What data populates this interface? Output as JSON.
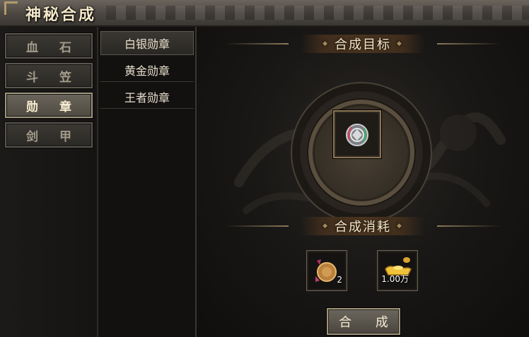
{
  "window": {
    "title": "神秘合成"
  },
  "tabs": [
    {
      "label": "血 石",
      "active": false
    },
    {
      "label": "斗 笠",
      "active": false
    },
    {
      "label": "勋 章",
      "active": true
    },
    {
      "label": "剑 甲",
      "active": false
    }
  ],
  "subitems": [
    {
      "label": "白银勋章",
      "active": true
    },
    {
      "label": "黄金勋章",
      "active": false
    },
    {
      "label": "王者勋章",
      "active": false
    }
  ],
  "target": {
    "header": "合成目标",
    "item_icon": "silver-medal-icon"
  },
  "cost": {
    "header": "合成消耗",
    "items": [
      {
        "icon": "medal-fragment-icon",
        "quantity": "2"
      },
      {
        "icon": "gold-ingot-icon",
        "quantity": "1.00万"
      }
    ]
  },
  "synth_button": {
    "label": "合 成"
  },
  "colors": {
    "gold": "#b39a6a",
    "text_light": "#f3e7c9",
    "panel_bg": "#121110"
  }
}
